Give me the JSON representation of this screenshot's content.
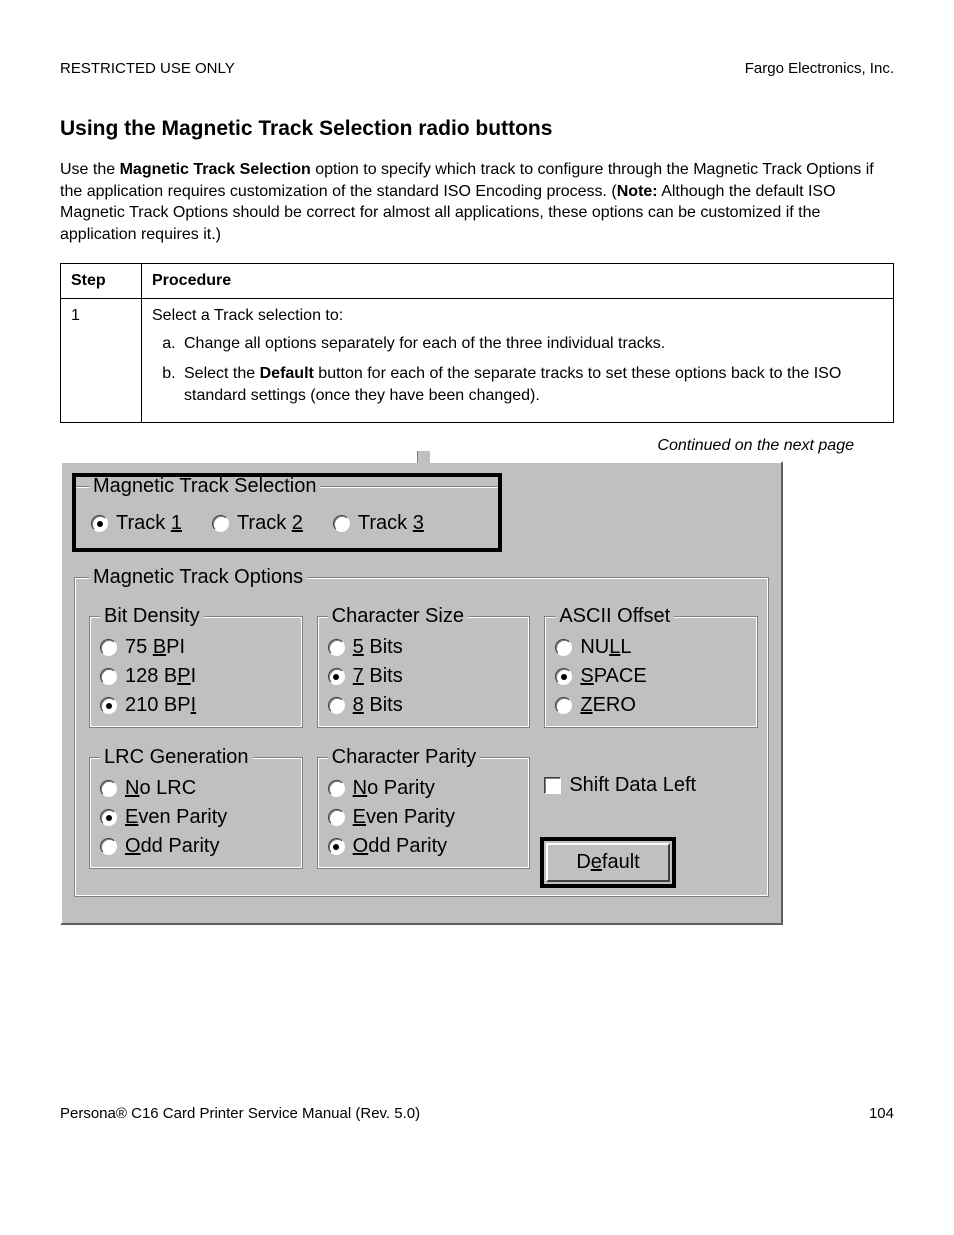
{
  "header": {
    "left": "RESTRICTED USE ONLY",
    "right": "Fargo Electronics, Inc."
  },
  "section_title": "Using the Magnetic Track Selection radio buttons",
  "intro": {
    "p1a": "Use the ",
    "p1b_bold": "Magnetic Track Selection",
    "p1c": " option to specify which track to configure through the Magnetic Track Options if the application requires customization of the standard ISO Encoding process. (",
    "p1d_bold": "Note:",
    "p1e": "  Although the default ISO Magnetic Track Options should be correct for almost all applications, these options can be customized if the application requires it.)"
  },
  "table": {
    "h1": "Step",
    "h2": "Procedure",
    "rows": [
      {
        "step": "1",
        "lead": "Select a Track selection to:",
        "items": [
          {
            "text": "Change all options separately for each of the three individual tracks."
          },
          {
            "pre": "Select the ",
            "bold": "Default",
            "post": " button for each of the separate tracks to set these options back to the ISO standard settings (once they have been changed)."
          }
        ]
      }
    ]
  },
  "continued": "Continued on the next page",
  "ui": {
    "track_selection": {
      "legend": "Magnetic Track Selection",
      "options": [
        {
          "pre": "Track ",
          "u": "1",
          "post": "",
          "selected": true
        },
        {
          "pre": "Track ",
          "u": "2",
          "post": "",
          "selected": false
        },
        {
          "pre": "Track ",
          "u": "3",
          "post": "",
          "selected": false
        }
      ]
    },
    "track_options": {
      "legend": "Magnetic Track Options",
      "bit_density": {
        "legend": "Bit Density",
        "options": [
          {
            "pre": "  75 ",
            "u": "B",
            "post": "PI",
            "selected": false
          },
          {
            "pre": "128 B",
            "u": "P",
            "post": "I",
            "selected": false
          },
          {
            "pre": "210 BP",
            "u": "I",
            "post": "",
            "selected": true
          }
        ]
      },
      "char_size": {
        "legend": "Character Size",
        "options": [
          {
            "pre": "",
            "u": "5",
            "post": " Bits",
            "selected": false
          },
          {
            "pre": "",
            "u": "7",
            "post": " Bits",
            "selected": true
          },
          {
            "pre": "",
            "u": "8",
            "post": " Bits",
            "selected": false
          }
        ]
      },
      "ascii_offset": {
        "legend": "ASCII Offset",
        "options": [
          {
            "pre": "NU",
            "u": "L",
            "post": "L",
            "selected": false
          },
          {
            "pre": "",
            "u": "S",
            "post": "PACE",
            "selected": true
          },
          {
            "pre": "",
            "u": "Z",
            "post": "ERO",
            "selected": false
          }
        ]
      },
      "lrc": {
        "legend": "LRC Generation",
        "options": [
          {
            "pre": "",
            "u": "N",
            "post": "o LRC",
            "selected": false
          },
          {
            "pre": "",
            "u": "E",
            "post": "ven Parity",
            "selected": true
          },
          {
            "pre": "",
            "u": "O",
            "post": "dd Parity",
            "selected": false
          }
        ]
      },
      "char_parity": {
        "legend": "Character Parity",
        "options": [
          {
            "pre": "",
            "u": "N",
            "post": "o Parity",
            "selected": false
          },
          {
            "pre": "",
            "u": "E",
            "post": "ven Parity",
            "selected": false
          },
          {
            "pre": "",
            "u": "O",
            "post": "dd Parity",
            "selected": true
          }
        ]
      },
      "shift_label": "Shift Data Left",
      "default_btn": {
        "pre": "D",
        "u": "e",
        "post": "fault"
      }
    }
  },
  "footer": {
    "left_a": "Persona",
    "left_reg": "®",
    "left_b": " C16 Card Printer Service Manual (Rev. 5.0)",
    "page": "104"
  }
}
